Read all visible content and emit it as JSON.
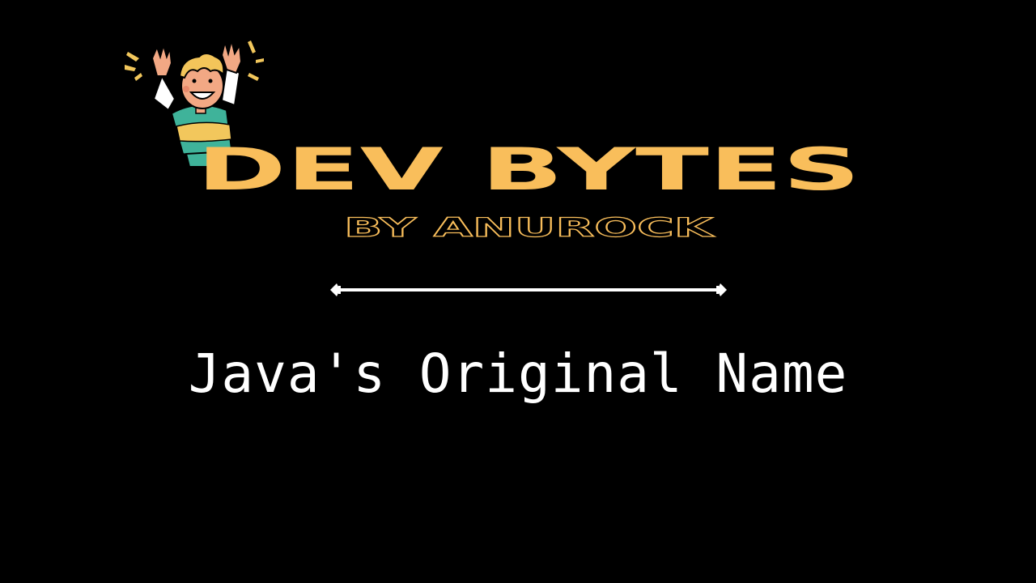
{
  "brand": {
    "title": "DEV BYTES",
    "subtitle": "BY ANUROCK"
  },
  "topic": {
    "title": "Java's Original Name"
  },
  "colors": {
    "background": "#000000",
    "brand_accent": "#F9BE5B",
    "text": "#FFFFFF",
    "mascot_shirt": "#3FB39A",
    "mascot_stripe": "#F2C75C",
    "mascot_hair": "#F3C55A",
    "mascot_skin": "#F2A884"
  },
  "icons": {
    "mascot": "cheering-boy-illustration",
    "divider": "ornamental-line"
  }
}
